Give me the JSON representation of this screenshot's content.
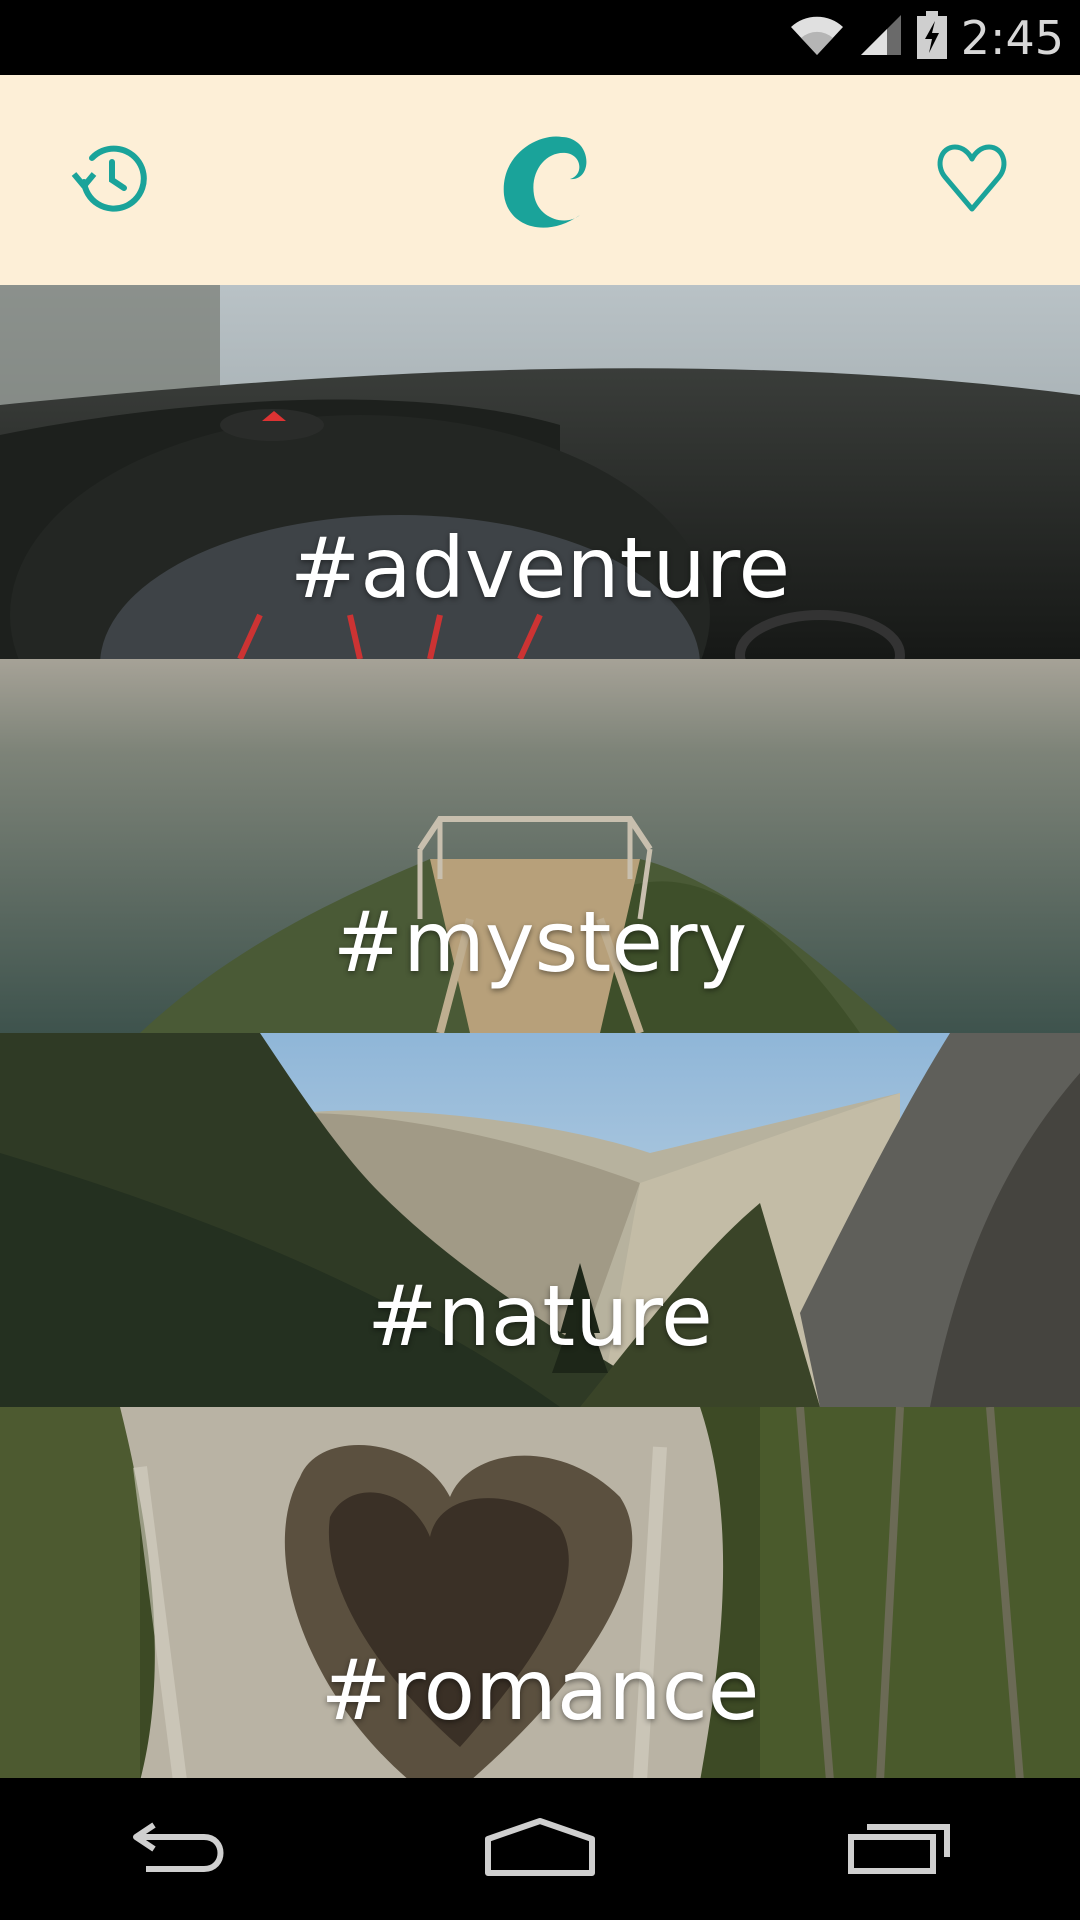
{
  "status_bar": {
    "time": "2:45"
  },
  "header": {
    "accent_color": "#1aa39a",
    "background": "#fdefd7",
    "history_icon": "history-icon",
    "logo_icon": "c-logo",
    "favorites_icon": "heart-icon"
  },
  "categories": [
    {
      "label": "#adventure",
      "image": "car-dashboard-speedometer"
    },
    {
      "label": "#mystery",
      "image": "cliff-overlook-ocean"
    },
    {
      "label": "#nature",
      "image": "mountain-valley-forest"
    },
    {
      "label": "#romance",
      "image": "heart-shaped-tree-hollow"
    }
  ],
  "nav_bar": {
    "icons": [
      "back-icon",
      "home-icon",
      "recents-icon"
    ]
  }
}
